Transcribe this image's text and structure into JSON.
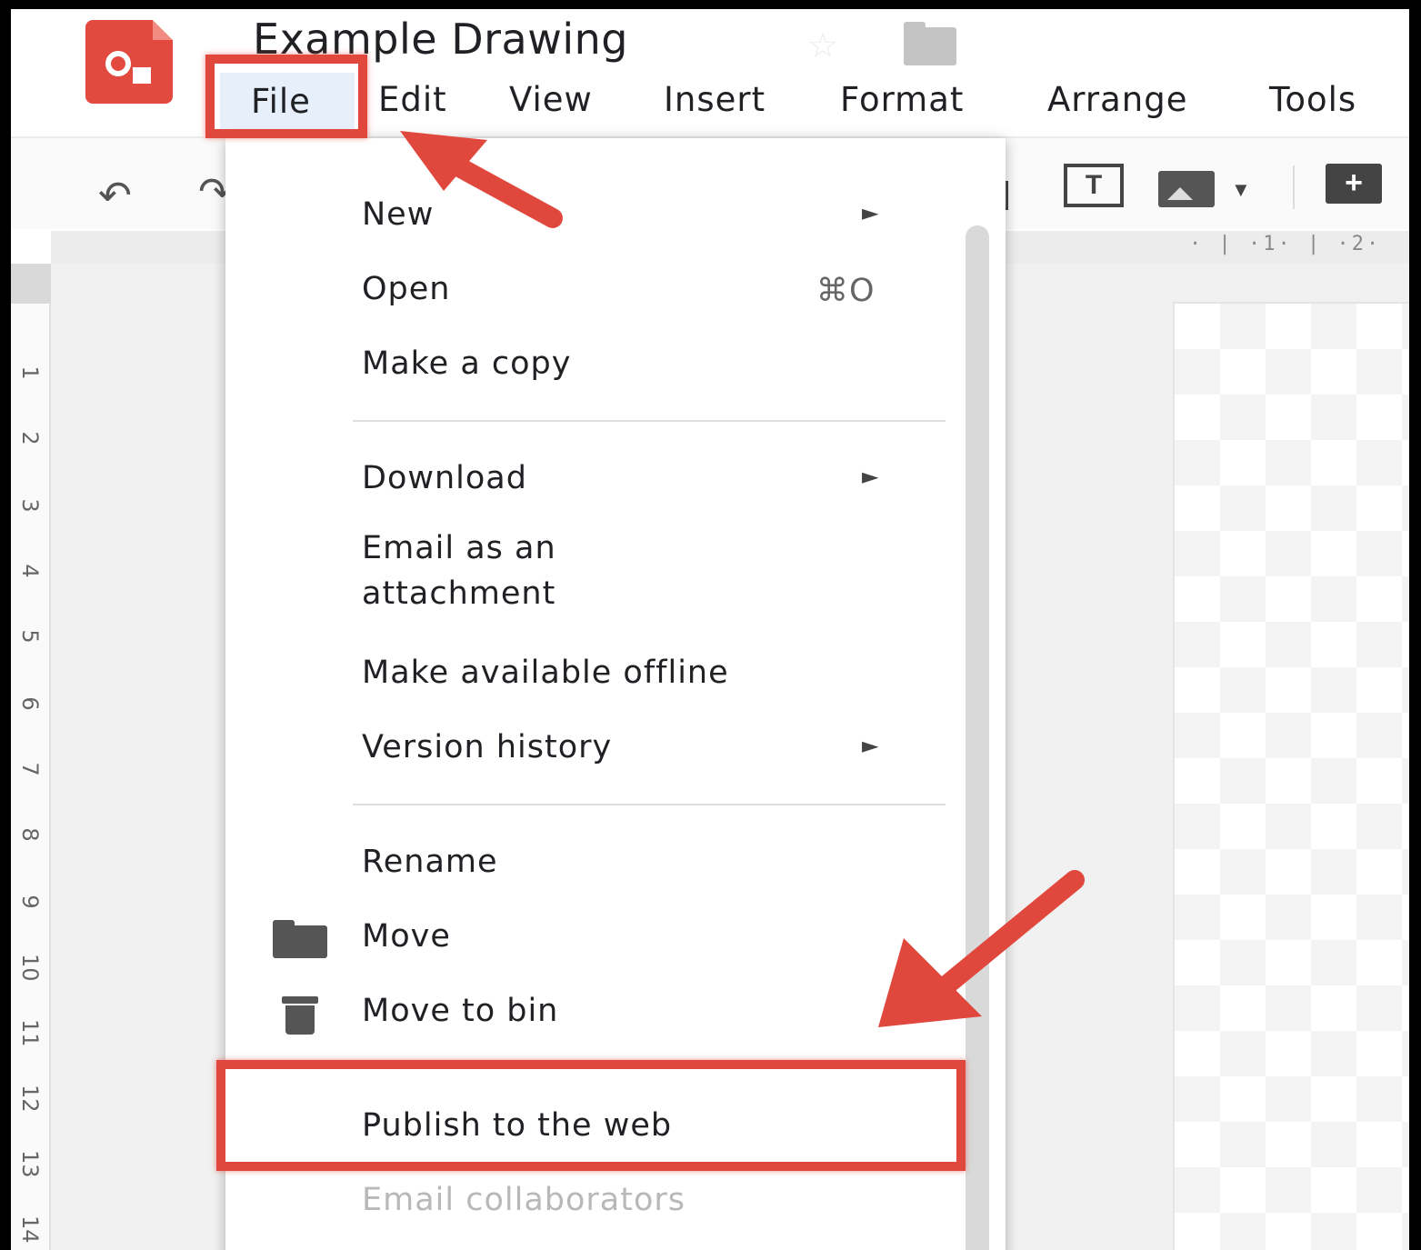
{
  "app": {
    "document_title": "Example Drawing"
  },
  "menubar": {
    "items": [
      "File",
      "Edit",
      "View",
      "Insert",
      "Format",
      "Arrange",
      "Tools"
    ]
  },
  "toolbar": {
    "textbox_letter": "T",
    "comment_symbol": "+"
  },
  "ruler": {
    "top_labels": "· | ·1· | ·2·",
    "left_ticks": [
      "1",
      "2",
      "3",
      "4",
      "5",
      "6",
      "7",
      "8",
      "9",
      "10",
      "11",
      "12",
      "13",
      "14"
    ]
  },
  "file_menu": {
    "new": {
      "label": "New",
      "submenu": "►"
    },
    "open": {
      "label": "Open",
      "shortcut": "⌘O"
    },
    "make_copy": {
      "label": "Make a copy"
    },
    "download": {
      "label": "Download",
      "submenu": "►"
    },
    "email_attachment": {
      "label_line1": "Email as an",
      "label_line2": "attachment"
    },
    "offline": {
      "label": "Make available offline"
    },
    "version_history": {
      "label": "Version history",
      "submenu": "►"
    },
    "rename": {
      "label": "Rename"
    },
    "move": {
      "label": "Move"
    },
    "move_to_bin": {
      "label": "Move to bin"
    },
    "publish": {
      "label": "Publish to the web"
    },
    "email_collaborators": {
      "label": "Email collaborators",
      "disabled": true
    }
  },
  "colors": {
    "annotation_red": "#e0483d",
    "file_highlight": "#e7effa",
    "brand_red": "#e34a3f"
  },
  "icons": [
    "drawings-logo-icon",
    "star-icon",
    "folder-icon",
    "undo-icon",
    "redo-icon",
    "select-icon",
    "textbox-icon",
    "image-icon",
    "comment-add-icon",
    "submenu-arrow-icon",
    "move-folder-icon",
    "bin-icon",
    "annotation-arrow-icon"
  ]
}
